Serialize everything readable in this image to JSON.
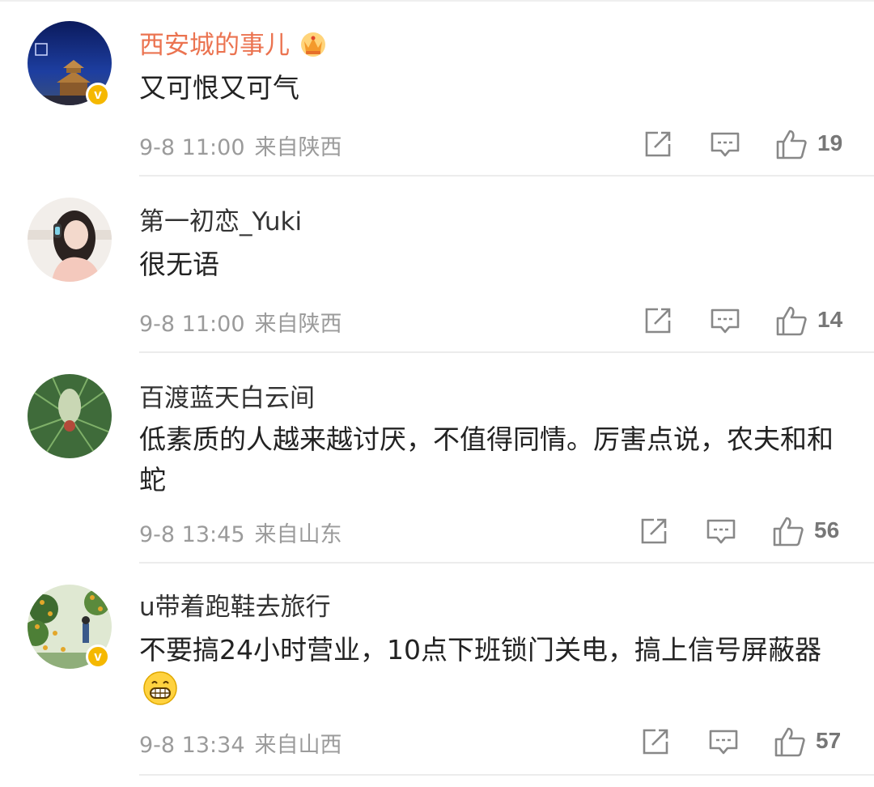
{
  "comments": [
    {
      "username": "西安城的事儿",
      "text": "又可恨又可气",
      "time": "9-8 11:00",
      "source": "来自陕西",
      "likes": "19",
      "verified": true,
      "vip": true
    },
    {
      "username": "第一初恋_Yuki",
      "text": "很无语",
      "time": "9-8 11:00",
      "source": "来自陕西",
      "likes": "14",
      "verified": false,
      "vip": false
    },
    {
      "username": "百渡蓝天白云间",
      "text": "低素质的人越来越讨厌，不值得同情。厉害点说，农夫和和蛇",
      "time": "9-8 13:45",
      "source": "来自山东",
      "likes": "56",
      "verified": false,
      "vip": false
    },
    {
      "username": "u带着跑鞋去旅行",
      "text": "不要搞24小时营业，10点下班锁门关电，搞上信号屏蔽器",
      "time": "9-8 13:34",
      "source": "来自山西",
      "likes": "57",
      "verified": true,
      "vip": false
    }
  ],
  "colors": {
    "vip_name": "#eb7350",
    "verified_badge": "#f5b800",
    "meta_gray": "#9b9b9b"
  },
  "icons": {
    "repost": "repost-icon",
    "comment": "comment-icon",
    "like": "like-icon",
    "verified": "verified-badge-icon",
    "vip": "vip-crown-icon",
    "emoji": "grin-emoji-icon"
  }
}
